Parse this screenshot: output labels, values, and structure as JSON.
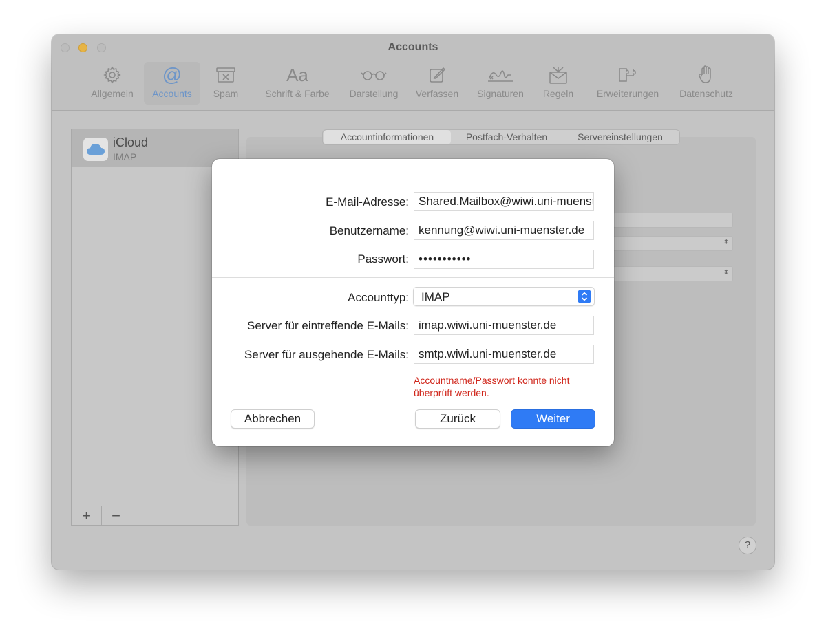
{
  "window": {
    "title": "Accounts"
  },
  "toolbar": {
    "items": [
      {
        "label": "Allgemein",
        "icon": "gear-icon"
      },
      {
        "label": "Accounts",
        "icon": "at-icon"
      },
      {
        "label": "Spam",
        "icon": "junk-icon"
      },
      {
        "label": "Schrift & Farbe",
        "icon": "Aa"
      },
      {
        "label": "Darstellung",
        "icon": "glasses-icon"
      },
      {
        "label": "Verfassen",
        "icon": "compose-icon"
      },
      {
        "label": "Signaturen",
        "icon": "signature-icon"
      },
      {
        "label": "Regeln",
        "icon": "rules-icon"
      },
      {
        "label": "Erweiterungen",
        "icon": "puzzle-icon"
      },
      {
        "label": "Datenschutz",
        "icon": "hand-icon"
      }
    ],
    "active": "Accounts"
  },
  "sidebar": {
    "accounts": [
      {
        "name": "iCloud",
        "type": "IMAP"
      }
    ],
    "add_label": "+",
    "remove_label": "−"
  },
  "tabs": [
    "Accountinformationen",
    "Postfach-Verhalten",
    "Servereinstellungen"
  ],
  "help_label": "?",
  "dialog": {
    "email_label": "E-Mail-Adresse:",
    "email_value": "Shared.Mailbox@wiwi.uni-muenster.de",
    "username_label": "Benutzername:",
    "username_value": "kennung@wiwi.uni-muenster.de",
    "password_label": "Passwort:",
    "password_value": "•••••••••••",
    "account_type_label": "Accounttyp:",
    "account_type_value": "IMAP",
    "incoming_label": "Server für eintreffende E-Mails:",
    "incoming_value": "imap.wiwi.uni-muenster.de",
    "outgoing_label": "Server für ausgehende E-Mails:",
    "outgoing_value": "smtp.wiwi.uni-muenster.de",
    "error_text": "Accountname/Passwort konnte nicht überprüft werden.",
    "cancel_label": "Abbrechen",
    "back_label": "Zurück",
    "next_label": "Weiter"
  },
  "colors": {
    "accent": "#2f7bf5",
    "error": "#d0271c"
  }
}
